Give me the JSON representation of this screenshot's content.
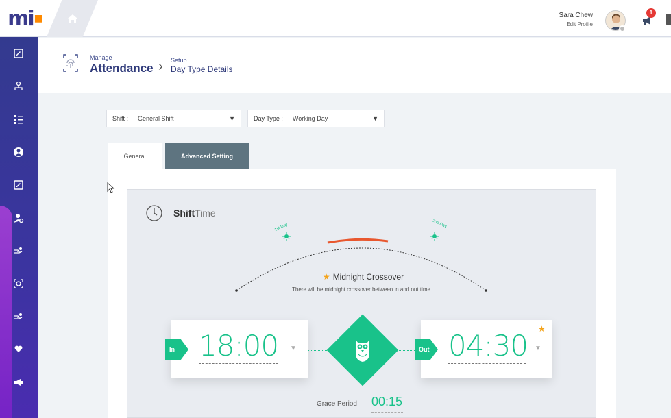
{
  "topbar": {
    "logo_text": "mi",
    "user_name": "Sara Chew",
    "user_link": "Edit Profile",
    "notification_count": "1"
  },
  "header": {
    "crumb1_small": "Manage",
    "crumb1_big": "Attendance",
    "crumb2_small": "Setup",
    "crumb2_big": "Day Type Details"
  },
  "filters": {
    "shift_label": "Shift :",
    "shift_value": "General Shift",
    "daytype_label": "Day Type :",
    "daytype_value": "Working Day"
  },
  "tabs": {
    "general": "General",
    "advanced": "Advanced Setting"
  },
  "shift_time": {
    "title_bold": "Shift",
    "title_light": "Time",
    "day1_label": "1st Day",
    "day2_label": "2nd Day",
    "crossover_title": "Midnight Crossover",
    "crossover_desc": "There will be midnight crossover between in and out time",
    "in_label": "In",
    "in_time": "18:00",
    "out_label": "Out",
    "out_time": "04:30",
    "grace_label": "Grace Period",
    "grace_value": "00:15"
  },
  "colors": {
    "accent": "#19c28a",
    "sidebar": "#333a8f",
    "orange": "#f4a41c",
    "arc_highlight": "#e8572e"
  }
}
